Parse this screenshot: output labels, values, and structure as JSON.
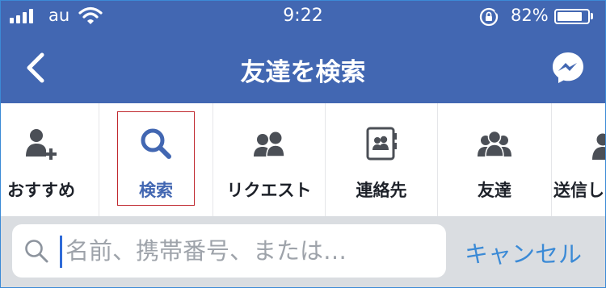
{
  "status_bar": {
    "carrier": "au",
    "time": "9:22",
    "battery_percent": "82%",
    "battery_level": 0.82,
    "icons": [
      "signal-icon",
      "wifi-icon",
      "rotation-lock-icon",
      "battery-icon"
    ]
  },
  "nav": {
    "title": "友達を検索",
    "back_icon": "chevron-left-icon",
    "messenger_icon": "messenger-icon"
  },
  "tabs": [
    {
      "label": "おすすめ",
      "icon": "add-person-icon",
      "active": false
    },
    {
      "label": "検索",
      "icon": "search-icon",
      "active": true
    },
    {
      "label": "リクエスト",
      "icon": "friends-icon",
      "active": false
    },
    {
      "label": "連絡先",
      "icon": "contacts-icon",
      "active": false
    },
    {
      "label": "友達",
      "icon": "group-icon",
      "active": false
    },
    {
      "label": "送信し",
      "icon": "person-icon",
      "active": false
    }
  ],
  "search": {
    "placeholder": "名前、携帯番号、または…",
    "value": "",
    "cancel_label": "キャンセル"
  },
  "colors": {
    "header": "#4267b2",
    "active_tab": "#4267b2",
    "cancel": "#3b8ad6",
    "highlight_border": "#c0282e"
  }
}
